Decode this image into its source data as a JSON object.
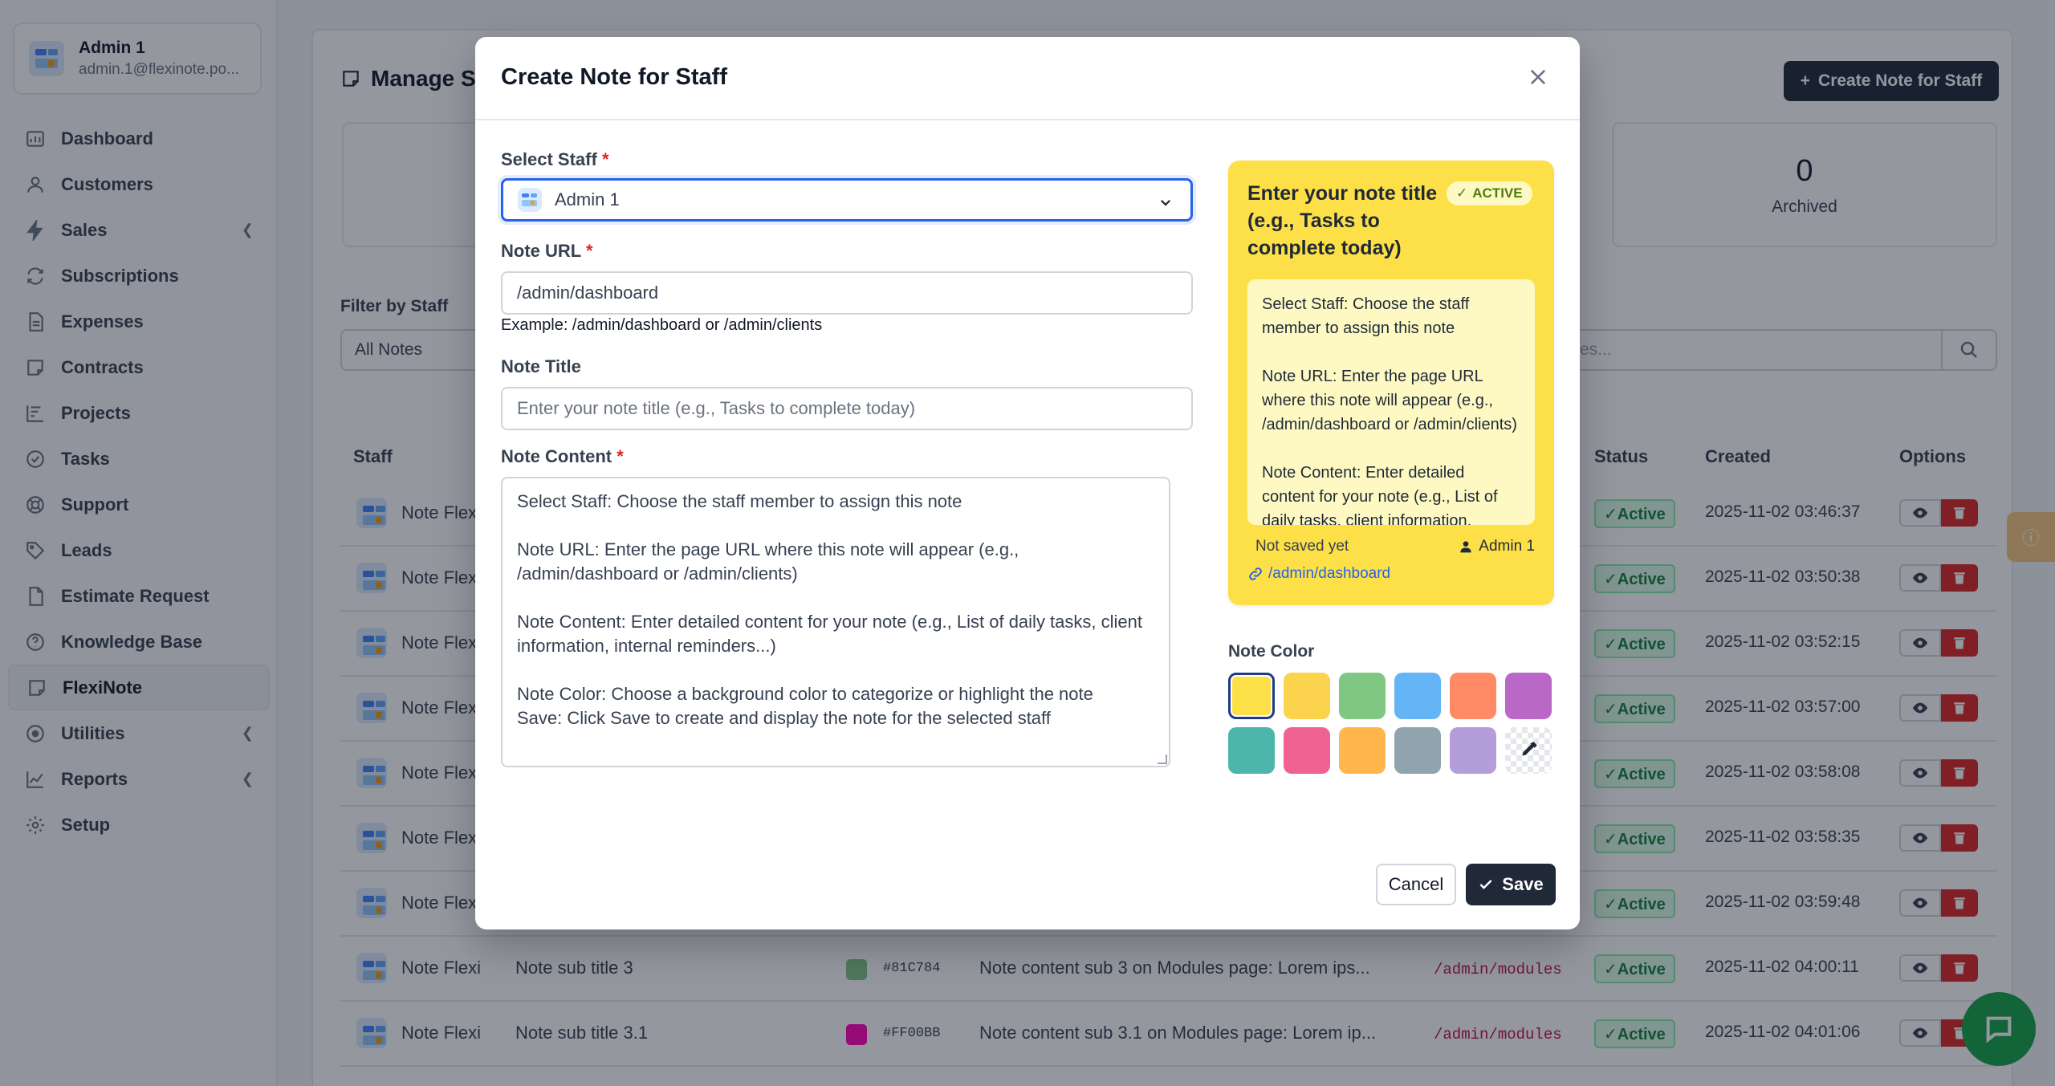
{
  "profile": {
    "name": "Admin 1",
    "email": "admin.1@flexinote.po..."
  },
  "nav": [
    {
      "label": "Dashboard",
      "icon": "dashboard-icon"
    },
    {
      "label": "Customers",
      "icon": "user-icon"
    },
    {
      "label": "Sales",
      "icon": "bolt-icon",
      "chevron": true
    },
    {
      "label": "Subscriptions",
      "icon": "refresh-icon"
    },
    {
      "label": "Expenses",
      "icon": "file-icon"
    },
    {
      "label": "Contracts",
      "icon": "note-icon"
    },
    {
      "label": "Projects",
      "icon": "chart-icon"
    },
    {
      "label": "Tasks",
      "icon": "check-circle-icon"
    },
    {
      "label": "Support",
      "icon": "lifebuoy-icon"
    },
    {
      "label": "Leads",
      "icon": "tag-icon"
    },
    {
      "label": "Estimate Request",
      "icon": "document-icon"
    },
    {
      "label": "Knowledge Base",
      "icon": "question-icon"
    },
    {
      "label": "FlexiNote",
      "icon": "note-icon",
      "active": true
    },
    {
      "label": "Utilities",
      "icon": "target-icon",
      "chevron": true
    },
    {
      "label": "Reports",
      "icon": "line-chart-icon",
      "chevron": true
    },
    {
      "label": "Setup",
      "icon": "gear-icon"
    }
  ],
  "page": {
    "title": "Manage S",
    "create_button": "Create Note for Staff",
    "archived_count": "0",
    "archived_label": "Archived",
    "filter_label": "Filter by Staff",
    "filter_value": "All Notes",
    "search_placeholder": "es...",
    "columns": {
      "staff": "Staff",
      "status": "Status",
      "created": "Created",
      "options": "Options"
    }
  },
  "rows": [
    {
      "staff": "Note Flex",
      "sub": "",
      "hex": "",
      "color": "",
      "content": "",
      "url": "",
      "status": "✓Active",
      "created": "2025-11-02 03:46:37"
    },
    {
      "staff": "Note Flex",
      "sub": "",
      "hex": "",
      "color": "",
      "content": "",
      "url": "",
      "status": "✓Active",
      "created": "2025-11-02 03:50:38"
    },
    {
      "staff": "Note Flex",
      "sub": "",
      "hex": "",
      "color": "",
      "content": "",
      "url": "",
      "status": "✓Active",
      "created": "2025-11-02 03:52:15"
    },
    {
      "staff": "Note Flex",
      "sub": "",
      "hex": "",
      "color": "",
      "content": "",
      "url": "",
      "status": "✓Active",
      "created": "2025-11-02 03:57:00"
    },
    {
      "staff": "Note Flex",
      "sub": "",
      "hex": "",
      "color": "",
      "content": "",
      "url": "",
      "status": "✓Active",
      "created": "2025-11-02 03:58:08"
    },
    {
      "staff": "Note Flex",
      "sub": "",
      "hex": "",
      "color": "",
      "content": "",
      "url": "",
      "status": "✓Active",
      "created": "2025-11-02 03:58:35"
    },
    {
      "staff": "Note Flex",
      "sub": "",
      "hex": "",
      "color": "",
      "content": "",
      "url": "",
      "status": "✓Active",
      "created": "2025-11-02 03:59:48"
    },
    {
      "staff": "Note Flexi",
      "sub": "Note sub title 3",
      "hex": "#81C784",
      "color": "#81C784",
      "content": "Note content sub 3 on Modules page: Lorem ips...",
      "url": "/admin/modules",
      "status": "✓Active",
      "created": "2025-11-02 04:00:11"
    },
    {
      "staff": "Note Flexi",
      "sub": "Note sub title 3.1",
      "hex": "#FF00BB",
      "color": "#FF00BB",
      "content": "Note content sub 3.1 on Modules page: Lorem ip...",
      "url": "/admin/modules",
      "status": "✓Active",
      "created": "2025-11-02 04:01:06"
    }
  ],
  "modal": {
    "title": "Create Note for Staff",
    "staff_label": "Select Staff",
    "staff_value": "Admin 1",
    "url_label": "Note URL",
    "url_value": "/admin/dashboard",
    "url_help": "Example: /admin/dashboard or /admin/clients",
    "title_label": "Note Title",
    "title_placeholder": "Enter your note title (e.g., Tasks to complete today)",
    "content_label": "Note Content",
    "content_value": "Select Staff: Choose the staff member to assign this note\n\nNote URL: Enter the page URL where this note will appear (e.g., /admin/dashboard or /admin/clients)\n\nNote Content: Enter detailed content for your note (e.g., List of daily tasks, client information, internal reminders...)\n\nNote Color: Choose a background color to categorize or highlight the note\nSave: Click Save to create and display the note for the selected staff",
    "required_mark": "*",
    "color_label": "Note Color",
    "colors": [
      "#FDE047",
      "#FCD34D",
      "#81C784",
      "#64B5F6",
      "#FF8A65",
      "#BA68C8",
      "#4DB6AC",
      "#F06292",
      "#FFB74D",
      "#90A4AE",
      "#B39DDB"
    ],
    "selected_color": "#FDE047",
    "cancel_label": "Cancel",
    "save_label": "Save"
  },
  "preview": {
    "title": "Enter your note title (e.g., Tasks to complete today)",
    "badge": "ACTIVE",
    "content": "Select Staff: Choose the staff member to assign this note\n\nNote URL: Enter the page URL where this note will appear (e.g., /admin/dashboard or /admin/clients)\n\nNote Content: Enter detailed content for your note (e.g., List of daily tasks, client information, internal reminders...)",
    "saved_status": "Not saved yet",
    "user": "Admin 1",
    "url": "/admin/dashboard"
  }
}
